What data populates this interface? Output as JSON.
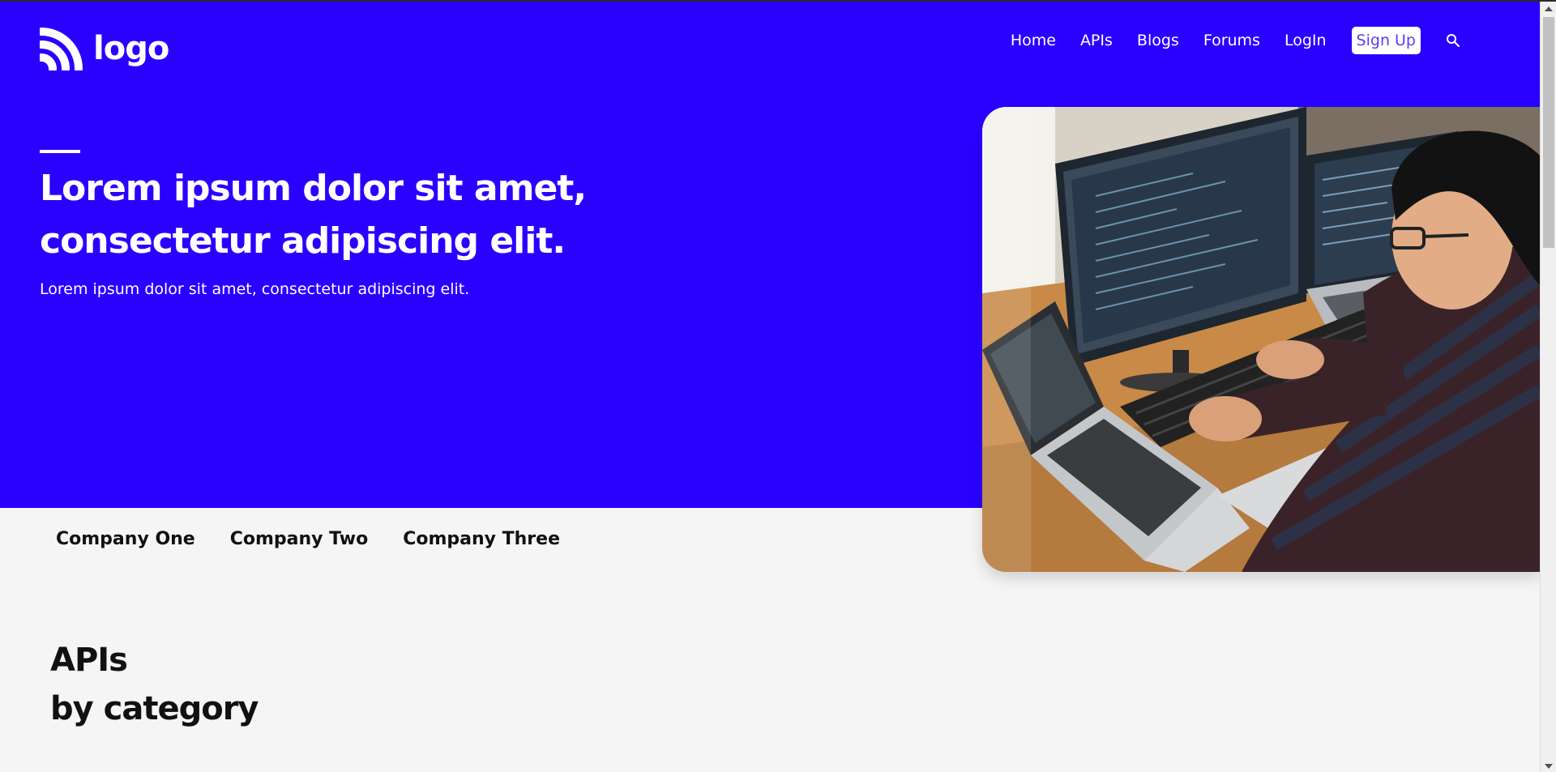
{
  "header": {
    "logo_text": "logo",
    "nav": [
      {
        "label": "Home"
      },
      {
        "label": "APIs"
      },
      {
        "label": "Blogs"
      },
      {
        "label": "Forums"
      },
      {
        "label": "LogIn"
      }
    ],
    "signup_label": "Sign Up",
    "search_icon": "search-icon"
  },
  "hero": {
    "title": "Lorem ipsum dolor sit amet, consectetur adipiscing elit.",
    "subtitle": "Lorem ipsum dolor sit amet, consectetur adipiscing elit.",
    "photo_icon": "developer-at-computer-photo"
  },
  "companies": [
    {
      "label": "Company One"
    },
    {
      "label": "Company Two"
    },
    {
      "label": "Company Three"
    }
  ],
  "apis_section": {
    "title_line1": "APIs",
    "title_line2": "by category"
  },
  "colors": {
    "brand": "#2a00ff",
    "background": "#f5f5f5",
    "signup_text": "#5a3df5"
  }
}
